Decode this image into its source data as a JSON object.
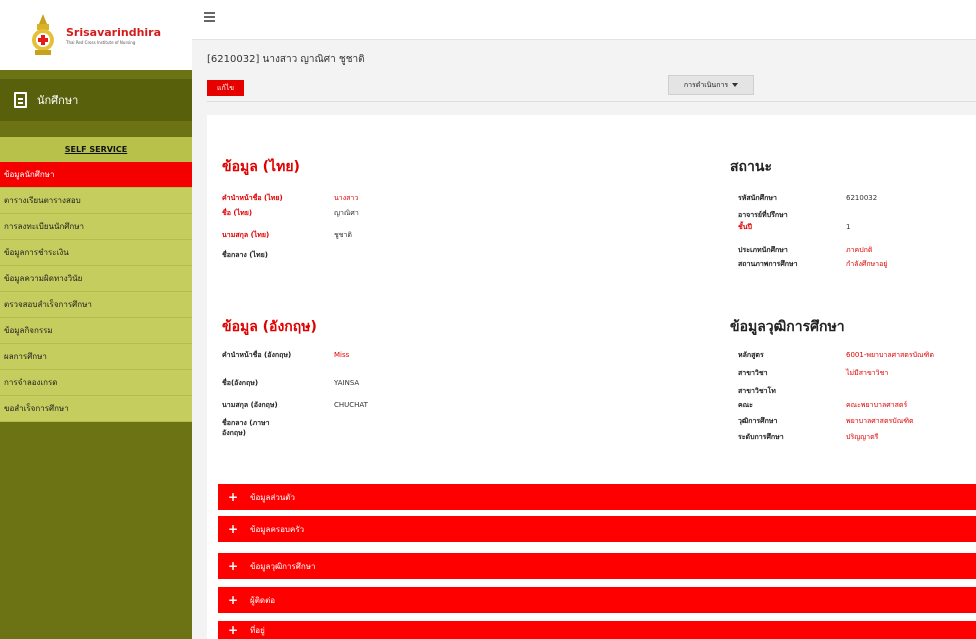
{
  "logo": {
    "title": "Srisavarindhira",
    "subtitle": "Thai Red Cross Institute of Nursing"
  },
  "sidebar": {
    "section_title": "นักศึกษา",
    "self_service": "SELF SERVICE",
    "items": [
      {
        "label": "ข้อมูลนักศึกษา",
        "active": true
      },
      {
        "label": "ตารางเรียนตารางสอบ",
        "active": false
      },
      {
        "label": "การลงทะเบียนนักศึกษา",
        "active": false
      },
      {
        "label": "ข้อมูลการชำระเงิน",
        "active": false
      },
      {
        "label": "ข้อมูลความผิดทางวินัย",
        "active": false
      },
      {
        "label": "ตรวจสอบสำเร็จการศึกษา",
        "active": false
      },
      {
        "label": "ข้อมูลกิจกรรม",
        "active": false
      },
      {
        "label": "ผลการศึกษา",
        "active": false
      },
      {
        "label": "การจำลองเกรด",
        "active": false
      },
      {
        "label": "ขอสำเร็จการศึกษา",
        "active": false
      }
    ]
  },
  "header": {
    "student_title": "[6210032] นางสาว ญาณิศา ชูชาติ",
    "edit_label": "แก้ไข",
    "actions_label": "การดำเนินการ"
  },
  "thai_info": {
    "title": "ข้อมูล (ไทย)",
    "rows": [
      {
        "label": "คำนำหน้าชื่อ (ไทย)",
        "value": "นางสาว"
      },
      {
        "label": "ชื่อ (ไทย)",
        "value": "ญาณิศา"
      },
      {
        "label": "นามสกุล (ไทย)",
        "value": "ชูชาติ"
      },
      {
        "label": "ชื่อกลาง (ไทย)",
        "value": ""
      }
    ]
  },
  "status": {
    "title": "สถานะ",
    "rows": [
      {
        "label": "รหัสนักศึกษา",
        "value": "6210032"
      },
      {
        "label": "อาจารย์ที่ปรึกษา",
        "value": ""
      },
      {
        "label": "ชั้นปี",
        "value": "1"
      },
      {
        "label": "ประเภทนักศึกษา",
        "value": "ภาคปกติ"
      },
      {
        "label": "สถานภาพการศึกษา",
        "value": "กำลังศึกษาอยู่"
      }
    ]
  },
  "english_info": {
    "title": "ข้อมูล (อังกฤษ)",
    "rows": [
      {
        "label": "คำนำหน้าชื่อ (อังกฤษ)",
        "value": "Miss"
      },
      {
        "label": "ชื่อ(อังกฤษ)",
        "value": "YAINSA"
      },
      {
        "label": "นามสกุล (อังกฤษ)",
        "value": "CHUCHAT"
      },
      {
        "label": "ชื่อกลาง (ภาษาอังกฤษ)",
        "value": ""
      }
    ]
  },
  "education": {
    "title": "ข้อมูลวุฒิการศึกษา",
    "rows": [
      {
        "label": "หลักสูตร",
        "value": "6001-พยาบาลศาสตรบัณฑิต"
      },
      {
        "label": "สาขาวิชา",
        "value": "ไม่มีสาขาวิชา"
      },
      {
        "label": "สาขาวิชาโท",
        "value": ""
      },
      {
        "label": "คณะ",
        "value": "คณะพยาบาลศาสตร์"
      },
      {
        "label": "วุฒิการศึกษา",
        "value": "พยาบาลศาสตรบัณฑิต"
      },
      {
        "label": "ระดับการศึกษา",
        "value": "ปริญญาตรี"
      }
    ]
  },
  "accordions": [
    {
      "label": "ข้อมูลส่วนตัว"
    },
    {
      "label": "ข้อมูลครอบครัว"
    },
    {
      "label": "ข้อมูลวุฒิการศึกษา"
    },
    {
      "label": "ผู้ติดต่อ"
    },
    {
      "label": "ที่อยู่"
    }
  ],
  "colors": {
    "sidebar": "#6b7314",
    "menu": "#c5cd5e",
    "accent": "#ff0000"
  }
}
